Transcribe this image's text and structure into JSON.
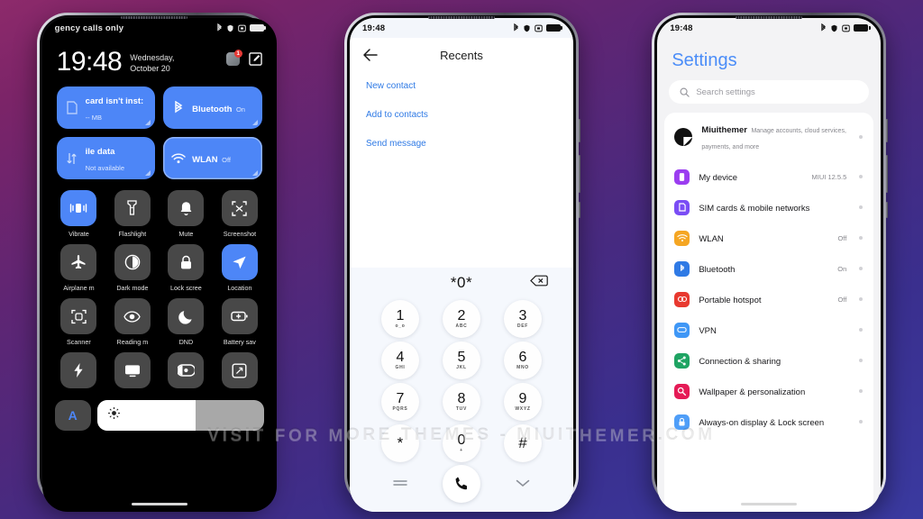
{
  "watermark": "VISIT FOR MORE THEMES - MIUITHEMER.COM",
  "colors": {
    "accent_blue": "#4d86f7",
    "tile_off": "#484848",
    "settings_title": "#4b8df8",
    "link_blue": "#2f7ae5",
    "bg_top": "#8d2a6b",
    "bg_bottom": "#3a3aa0"
  },
  "control_center": {
    "status": {
      "carrier": "gency calls only",
      "icons": [
        "bluetooth-icon",
        "shield-icon",
        "screenshot-icon",
        "battery-icon"
      ]
    },
    "clock": "19:48",
    "date": "Wednesday, October 20",
    "notification_badge": "1",
    "actions": [
      "app-badge-icon",
      "edit-icon"
    ],
    "big_tiles": [
      {
        "title": "card isn't inst:",
        "sub": "-- MB",
        "icon": "sim-icon",
        "active": true,
        "outlined": false
      },
      {
        "title": "Bluetooth",
        "sub": "On",
        "icon": "bluetooth-icon",
        "active": true,
        "outlined": false
      },
      {
        "title": "ile data",
        "sub": "Not available",
        "icon": "mobile-data-icon",
        "active": true,
        "outlined": false
      },
      {
        "title": "WLAN",
        "sub": "Off",
        "icon": "wifi-icon",
        "active": true,
        "outlined": true
      }
    ],
    "tiles": [
      {
        "label": "Vibrate",
        "icon": "vibrate-icon",
        "on": true
      },
      {
        "label": "Flashlight",
        "icon": "flashlight-icon",
        "on": false
      },
      {
        "label": "Mute",
        "icon": "bell-icon",
        "on": false
      },
      {
        "label": "Screenshot",
        "icon": "screenshot-icon",
        "on": false
      },
      {
        "label": "Airplane m",
        "icon": "airplane-icon",
        "on": false
      },
      {
        "label": "Dark mode",
        "icon": "contrast-icon",
        "on": false
      },
      {
        "label": "Lock scree",
        "icon": "lock-icon",
        "on": false
      },
      {
        "label": "Location",
        "icon": "location-icon",
        "on": true
      },
      {
        "label": "Scanner",
        "icon": "scanner-icon",
        "on": false
      },
      {
        "label": "Reading m",
        "icon": "eye-icon",
        "on": false
      },
      {
        "label": "DND",
        "icon": "moon-icon",
        "on": false
      },
      {
        "label": "Battery sav",
        "icon": "battery-saver-icon",
        "on": false
      },
      {
        "label": "",
        "icon": "flash-icon",
        "on": false
      },
      {
        "label": "",
        "icon": "cast-icon",
        "on": false
      },
      {
        "label": "",
        "icon": "color-mode-icon",
        "on": false
      },
      {
        "label": "",
        "icon": "rotate-icon",
        "on": false
      }
    ],
    "brightness": {
      "auto_label": "A",
      "level_percent": 59,
      "icon": "sun-icon"
    }
  },
  "dialer": {
    "status": {
      "time": "19:48"
    },
    "title": "Recents",
    "back_icon": "arrow-left-icon",
    "links": [
      "New contact",
      "Add to contacts",
      "Send message"
    ],
    "entered_number": "*0*",
    "delete_icon": "backspace-icon",
    "keys": [
      {
        "digit": "1",
        "sub": "o_o"
      },
      {
        "digit": "2",
        "sub": "ABC"
      },
      {
        "digit": "3",
        "sub": "DEF"
      },
      {
        "digit": "4",
        "sub": "GHI"
      },
      {
        "digit": "5",
        "sub": "JKL"
      },
      {
        "digit": "6",
        "sub": "MNO"
      },
      {
        "digit": "7",
        "sub": "PQRS"
      },
      {
        "digit": "8",
        "sub": "TUV"
      },
      {
        "digit": "9",
        "sub": "WXYZ"
      },
      {
        "digit": "*",
        "sub": ""
      },
      {
        "digit": "0",
        "sub": "+"
      },
      {
        "digit": "#",
        "sub": ""
      }
    ],
    "bottom": {
      "menu_icon": "dialpad-menu-icon",
      "call_icon": "call-icon",
      "hide_icon": "chevron-down-icon"
    }
  },
  "settings": {
    "status": {
      "time": "19:48"
    },
    "title": "Settings",
    "search": {
      "placeholder": "Search settings",
      "icon": "search-icon"
    },
    "account": {
      "name": "Miuithemer",
      "sub": "Manage accounts, cloud services, payments, and more",
      "avatar": "account-avatar"
    },
    "rows": [
      {
        "label": "My device",
        "value": "MIUI 12.5.5",
        "icon": "device-icon",
        "color": "#9b3df0"
      },
      {
        "label": "SIM cards & mobile networks",
        "value": "",
        "icon": "sim-icon",
        "color": "#7a4df5"
      },
      {
        "label": "WLAN",
        "value": "Off",
        "icon": "wifi-icon",
        "color": "#f5a623"
      },
      {
        "label": "Bluetooth",
        "value": "On",
        "icon": "bluetooth-icon",
        "color": "#2f7ae5"
      },
      {
        "label": "Portable hotspot",
        "value": "Off",
        "icon": "hotspot-icon",
        "color": "#e8392f"
      },
      {
        "label": "VPN",
        "value": "",
        "icon": "vpn-icon",
        "color": "#3f97f6"
      },
      {
        "label": "Connection & sharing",
        "value": "",
        "icon": "share-icon",
        "color": "#1fa463"
      },
      {
        "label": "Wallpaper & personalization",
        "value": "",
        "icon": "wallpaper-icon",
        "color": "#e51b56"
      },
      {
        "label": "Always-on display & Lock screen",
        "value": "",
        "icon": "lock-icon",
        "color": "#4f9ef8"
      }
    ]
  }
}
